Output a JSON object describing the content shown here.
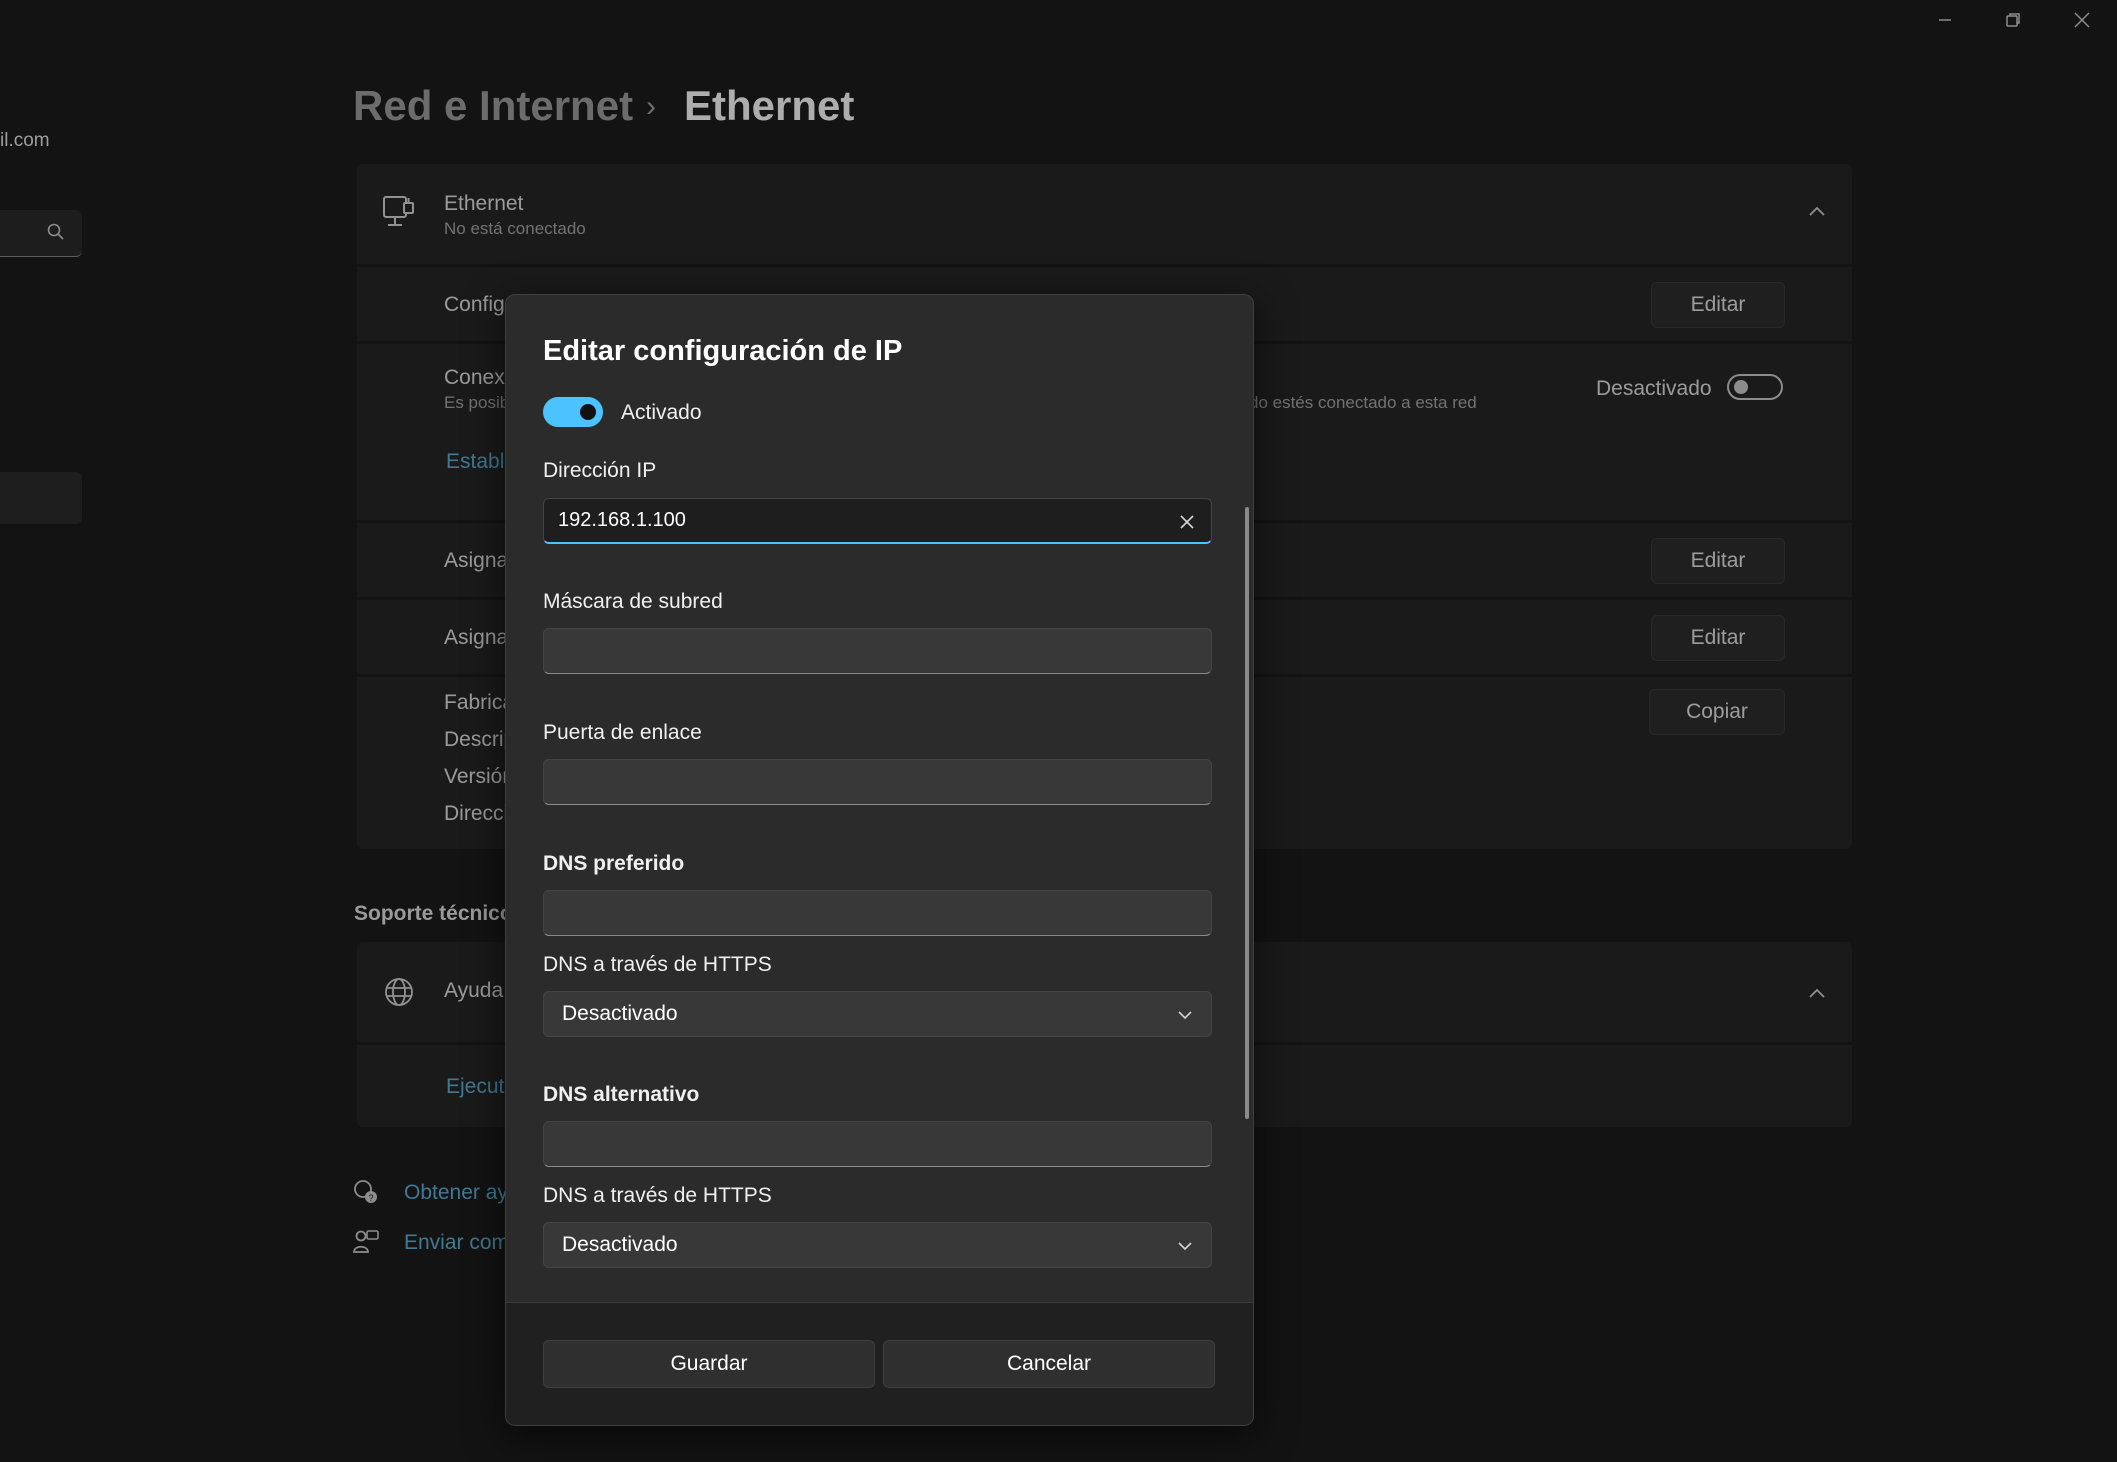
{
  "window": {
    "minimize_icon": "minimize-icon",
    "maximize_icon": "restore-icon",
    "close_icon": "close-icon"
  },
  "sidebar": {
    "email_fragment": "il.com",
    "search_icon": "search-icon"
  },
  "breadcrumb": {
    "parent": "Red e Internet",
    "separator": "›",
    "current": "Ethernet"
  },
  "ethernet_card": {
    "title": "Ethernet",
    "status": "No está conectado",
    "icon": "ethernet-icon",
    "rows": {
      "config_label": "Config",
      "config_button": "Editar",
      "metered_label": "Conexi",
      "metered_sub_left": "Es posib",
      "metered_sub_right": "do estés conectado a esta red",
      "metered_state": "Desactivado",
      "metered_link": "Estable",
      "assign1_label": "Asigna",
      "assign1_button": "Editar",
      "assign2_label": "Asigna",
      "assign2_button": "Editar",
      "props": [
        "Fabrica",
        "Descrip",
        "Versión",
        "Direcci"
      ],
      "copy_button": "Copiar"
    }
  },
  "support": {
    "heading": "Soporte técnico",
    "help_label": "Ayuda",
    "help_icon": "globe-icon",
    "run_link": "Ejecuta",
    "get_help": "Obtener ay",
    "send_feedback": "Enviar com"
  },
  "dialog": {
    "title": "Editar configuración de IP",
    "toggle_label": "Activado",
    "ip_label": "Dirección IP",
    "ip_value": "192.168.1.100",
    "subnet_label": "Máscara de subred",
    "subnet_value": "",
    "gateway_label": "Puerta de enlace",
    "gateway_value": "",
    "dns_pref_label": "DNS preferido",
    "dns_pref_value": "",
    "https1_label": "DNS a través de HTTPS",
    "https1_value": "Desactivado",
    "dns_alt_label": "DNS alternativo",
    "dns_alt_value": "",
    "https2_label": "DNS a través de HTTPS",
    "https2_value": "Desactivado",
    "save_button": "Guardar",
    "cancel_button": "Cancelar"
  },
  "colors": {
    "accent": "#4cc2ff",
    "link": "#5fb3d6",
    "background": "#1c1c1c",
    "card": "#272727",
    "dialog": "#2b2b2b"
  }
}
